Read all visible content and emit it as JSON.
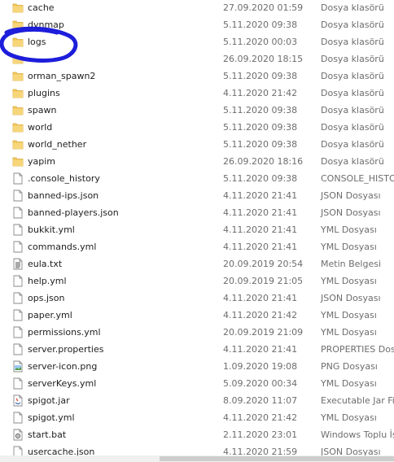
{
  "files": [
    {
      "name": "cache",
      "date": "27.09.2020 01:59",
      "type": "Dosya klasörü",
      "icon": "folder-icon"
    },
    {
      "name": "dynmap",
      "date": "5.11.2020 09:38",
      "type": "Dosya klasörü",
      "icon": "folder-icon"
    },
    {
      "name": "logs",
      "date": "5.11.2020 00:03",
      "type": "Dosya klasörü",
      "icon": "folder-icon"
    },
    {
      "name": "",
      "date": "26.09.2020 18:15",
      "type": "Dosya klasörü",
      "icon": "folder-icon"
    },
    {
      "name": "orman_spawn2",
      "date": "5.11.2020 09:38",
      "type": "Dosya klasörü",
      "icon": "folder-icon"
    },
    {
      "name": "plugins",
      "date": "4.11.2020 21:42",
      "type": "Dosya klasörü",
      "icon": "folder-icon"
    },
    {
      "name": "spawn",
      "date": "5.11.2020 09:38",
      "type": "Dosya klasörü",
      "icon": "folder-icon"
    },
    {
      "name": "world",
      "date": "5.11.2020 09:38",
      "type": "Dosya klasörü",
      "icon": "folder-icon"
    },
    {
      "name": "world_nether",
      "date": "5.11.2020 09:38",
      "type": "Dosya klasörü",
      "icon": "folder-icon"
    },
    {
      "name": "yapim",
      "date": "26.09.2020 18:16",
      "type": "Dosya klasörü",
      "icon": "folder-icon"
    },
    {
      "name": ".console_history",
      "date": "5.11.2020 09:38",
      "type": "CONSOLE_HISTORY",
      "icon": "file-icon"
    },
    {
      "name": "banned-ips.json",
      "date": "4.11.2020 21:41",
      "type": "JSON Dosyası",
      "icon": "file-icon"
    },
    {
      "name": "banned-players.json",
      "date": "4.11.2020 21:41",
      "type": "JSON Dosyası",
      "icon": "file-icon"
    },
    {
      "name": "bukkit.yml",
      "date": "4.11.2020 21:41",
      "type": "YML Dosyası",
      "icon": "file-icon"
    },
    {
      "name": "commands.yml",
      "date": "4.11.2020 21:41",
      "type": "YML Dosyası",
      "icon": "file-icon"
    },
    {
      "name": "eula.txt",
      "date": "20.09.2019 20:54",
      "type": "Metin Belgesi",
      "icon": "text-document-icon"
    },
    {
      "name": "help.yml",
      "date": "20.09.2019 21:05",
      "type": "YML Dosyası",
      "icon": "file-icon"
    },
    {
      "name": "ops.json",
      "date": "4.11.2020 21:41",
      "type": "JSON Dosyası",
      "icon": "file-icon"
    },
    {
      "name": "paper.yml",
      "date": "4.11.2020 21:42",
      "type": "YML Dosyası",
      "icon": "file-icon"
    },
    {
      "name": "permissions.yml",
      "date": "20.09.2019 21:09",
      "type": "YML Dosyası",
      "icon": "file-icon"
    },
    {
      "name": "server.properties",
      "date": "4.11.2020 21:41",
      "type": "PROPERTIES Dosyası",
      "icon": "file-icon"
    },
    {
      "name": "server-icon.png",
      "date": "1.09.2020 19:08",
      "type": "PNG Dosyası",
      "icon": "image-file-icon"
    },
    {
      "name": "serverKeys.yml",
      "date": "5.09.2020 00:34",
      "type": "YML Dosyası",
      "icon": "file-icon"
    },
    {
      "name": "spigot.jar",
      "date": "8.09.2020 11:07",
      "type": "Executable Jar File",
      "icon": "jar-file-icon"
    },
    {
      "name": "spigot.yml",
      "date": "4.11.2020 21:42",
      "type": "YML Dosyası",
      "icon": "file-icon"
    },
    {
      "name": "start.bat",
      "date": "2.11.2020 23:01",
      "type": "Windows Toplu İş Dosyası",
      "icon": "batch-file-icon"
    },
    {
      "name": "usercache.json",
      "date": "4.11.2020 21:59",
      "type": "JSON Dosyası",
      "icon": "file-icon"
    }
  ],
  "colors": {
    "folder": "#f0c85a",
    "annotation": "#1d1ddb",
    "date_text": "#6d6d6d",
    "name_text": "#1e1e1e"
  }
}
